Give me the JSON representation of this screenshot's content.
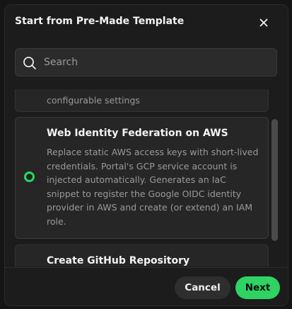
{
  "modal": {
    "title": "Start from Pre-Made Template"
  },
  "search": {
    "placeholder": "Search",
    "value": ""
  },
  "templates": [
    {
      "title": "",
      "description": "configurable settings",
      "selected": false
    },
    {
      "title": "Web Identity Federation on AWS",
      "description": "Replace static AWS access keys with short-lived credentials. Portal's GCP service account is injected automatically. Generates an IaC snippet to register the Google OIDC identity provider in AWS and create (or extend) an IAM role.",
      "selected": true
    },
    {
      "title": "Create GitHub Repository",
      "description": "",
      "selected": false
    }
  ],
  "footer": {
    "cancel_label": "Cancel",
    "next_label": "Next"
  },
  "colors": {
    "accent": "#2ed364",
    "modal_bg": "#1c1c1c",
    "card_bg": "#262626"
  },
  "icons": {
    "close": "close-icon",
    "search": "search-icon"
  }
}
